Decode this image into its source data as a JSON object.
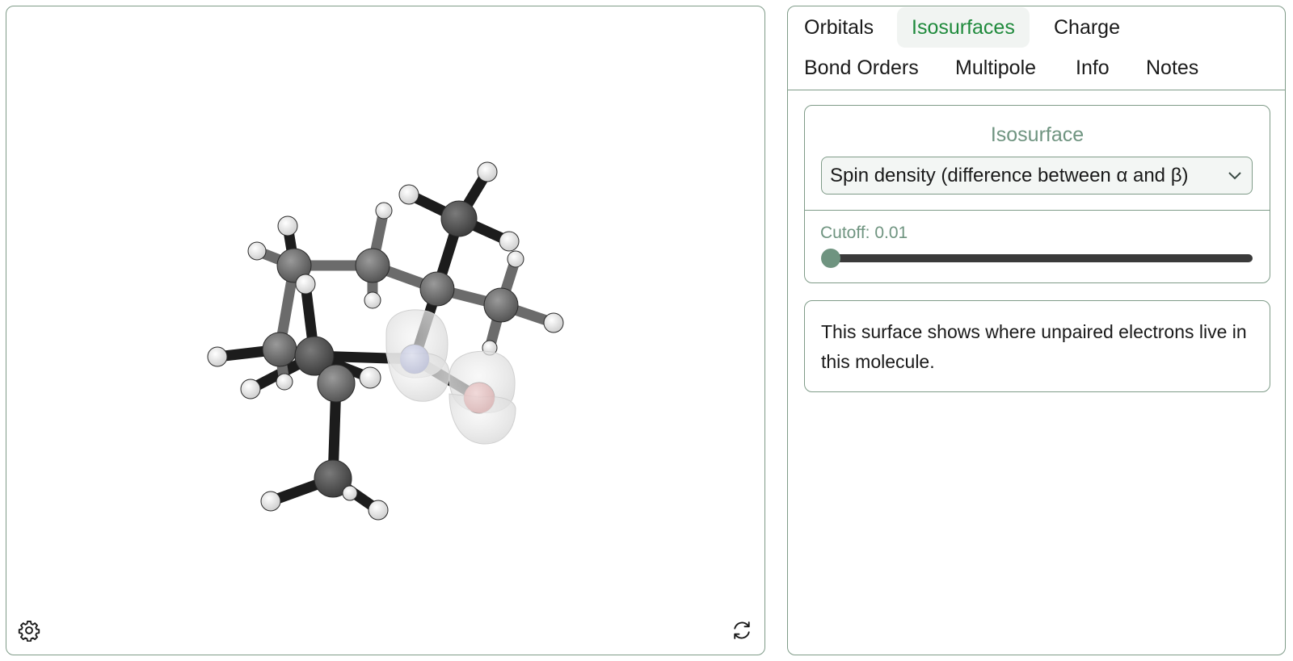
{
  "viewer": {
    "name": "molecule-viewer",
    "molecule": {
      "atoms": {
        "carbon": 9,
        "hydrogen": 18,
        "nitrogen": 1,
        "oxygen": 1
      },
      "isosurface_visible": true
    },
    "icons": {
      "settings": "gear-icon",
      "reset": "refresh-icon"
    }
  },
  "tabs": [
    {
      "label": "Orbitals",
      "active": false
    },
    {
      "label": "Isosurfaces",
      "active": true
    },
    {
      "label": "Charge",
      "active": false
    },
    {
      "label": "Bond Orders",
      "active": false
    },
    {
      "label": "Multipole",
      "active": false
    },
    {
      "label": "Info",
      "active": false
    },
    {
      "label": "Notes",
      "active": false
    }
  ],
  "isosurface": {
    "title": "Isosurface",
    "selected": "Spin density (difference between α and β)",
    "cutoff_label": "Cutoff: 0.01",
    "cutoff_value": 0.01,
    "slider_fraction": 0.0
  },
  "description": "This surface shows where unpaired electrons live in this molecule.",
  "colors": {
    "accent": "#1f8a3c",
    "border": "#7f9b88",
    "muted_green": "#6f9480",
    "nitrogen": "#c9cde6",
    "oxygen": "#e8c4c4"
  }
}
